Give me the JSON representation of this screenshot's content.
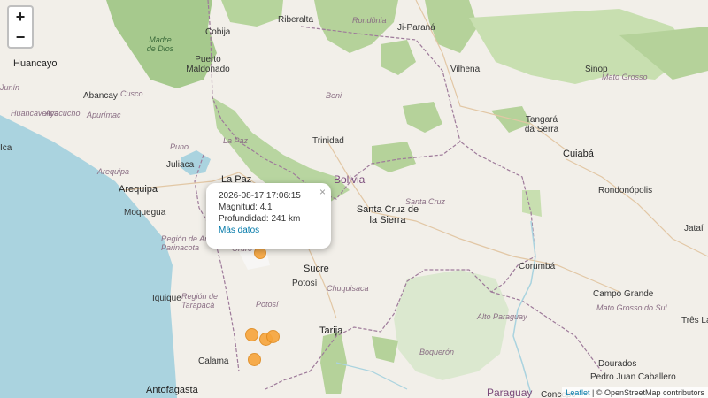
{
  "zoom": {
    "in_label": "+",
    "out_label": "−"
  },
  "popup": {
    "datetime": "2026-08-17 17:06:15",
    "magnitude": "Magnitud: 4.1",
    "depth": "Profundidad: 241 km",
    "link": "Más datos",
    "close": "×"
  },
  "labels": {
    "huancayo": "Huancayo",
    "abancay": "Abancay",
    "cusco": "Cusco",
    "ayacucho": "Ayacucho",
    "apurimac": "Apurímac",
    "huancavelica": "Huancavelica",
    "junin": "Junín",
    "ica": "Ica",
    "puno": "Puno",
    "juliaca": "Juliaca",
    "arequipa_reg": "Arequipa",
    "arequipa": "Arequipa",
    "moquegua": "Moquegua",
    "lapaz": "La Paz",
    "lapaz_reg": "La Paz",
    "cobija": "Cobija",
    "riberalta": "Riberalta",
    "puertomaldonado": "Puerto Maldonado",
    "madrededios": "Madre de Dios",
    "beni": "Beni",
    "trinidad": "Trinidad",
    "bolivia": "Bolivia",
    "santacruz_city": "Santa Cruz de la Sierra",
    "santacruz_reg": "Santa Cruz",
    "oruro": "Oruro",
    "sucre": "Sucre",
    "potosi": "Potosí",
    "potosi_reg": "Potosí",
    "chuquisaca": "Chuquisaca",
    "tarija": "Tarija",
    "arica": "Arica y Parinacota",
    "iquique": "Iquique",
    "tarapaca": "Región de Tarapacá",
    "calama": "Calama",
    "antofagasta": "Antofagasta",
    "rondonia": "Rondônia",
    "jiparana": "Ji-Paraná",
    "vilhena": "Vilhena",
    "sinop": "Sinop",
    "matogrosso": "Mato Grosso",
    "tangara": "Tangará da Serra",
    "cuiaba": "Cuiabá",
    "rondonopolis": "Rondonópolis",
    "jatai": "Jataí",
    "corumba": "Corumbá",
    "altoparaguay": "Alto Paraguay",
    "matogrossosul": "Mato Grosso do Sul",
    "campogrande": "Campo Grande",
    "trlagoas": "Três Lagoas",
    "boqueron": "Boquerón",
    "paraguay": "Paraguay",
    "pedrojuan": "Pedro Juan Caballero",
    "dourados": "Dourados",
    "concepcion": "Concepc",
    "regionarica": "Región de Arica y Parinacota"
  },
  "attribution": {
    "leaflet": "Leaflet",
    "osm": "| © OpenStreetMap contributors"
  }
}
